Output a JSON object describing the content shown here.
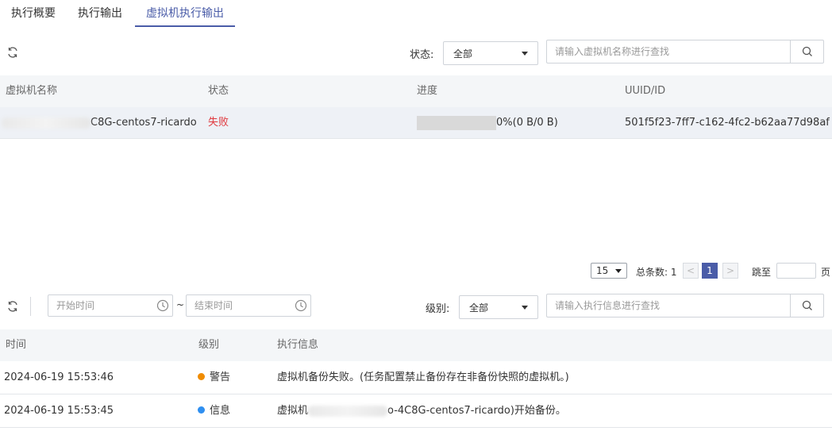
{
  "tabs": [
    {
      "label": "执行概要"
    },
    {
      "label": "执行输出"
    },
    {
      "label": "虚拟机执行输出"
    }
  ],
  "vm_section": {
    "status_label": "状态:",
    "status_select": "全部",
    "search_placeholder": "请输入虚拟机名称进行查找",
    "columns": [
      "虚拟机名称",
      "状态",
      "进度",
      "UUID/ID"
    ],
    "rows": [
      {
        "name_visible": "C8G-centos7-ricardo",
        "status": "失败",
        "progress_fraction": 0,
        "progress_text": "0%(0 B/0 B)",
        "uuid": "501f5f23-7ff7-c162-4fc2-b62aa77d98af"
      }
    ]
  },
  "pagination": {
    "page_size": "15",
    "total_label": "总条数: 1",
    "prev": "<",
    "current_page": "1",
    "next": ">",
    "jump_label": "跳至",
    "page_suffix": "页"
  },
  "log_section": {
    "start_placeholder": "开始时间",
    "tilde": "~",
    "end_placeholder": "结束时间",
    "level_label": "级别:",
    "level_select": "全部",
    "search_placeholder": "请输入执行信息进行查找",
    "columns": [
      "时间",
      "级别",
      "执行信息"
    ],
    "rows": [
      {
        "time": "2024-06-19 15:53:46",
        "level": "警告",
        "level_color": "#f08c00",
        "message": "虚拟机备份失败。(任务配置禁止备份存在非备份快照的虚拟机。)"
      },
      {
        "time": "2024-06-19 15:53:45",
        "level": "信息",
        "level_color": "#2f8ff0",
        "message_prefix": "虚拟机",
        "message_suffix": "o-4C8G-centos7-ricardo)开始备份。"
      }
    ]
  },
  "colors": {
    "accent": "#4a5ca8",
    "danger": "#e0383e",
    "header_bg": "#f4f6f8",
    "selected_row_bg": "#eef1f6"
  },
  "icons": [
    "refresh-icon",
    "search-icon",
    "chevron-down-icon",
    "clock-icon",
    "warning-dot-icon",
    "info-dot-icon"
  ]
}
